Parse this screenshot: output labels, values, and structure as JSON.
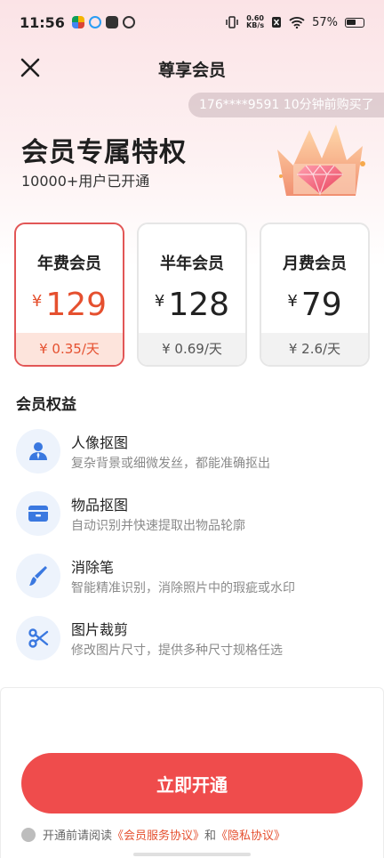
{
  "status": {
    "time": "11:56",
    "net_speed_top": "0.60",
    "net_speed_bottom": "KB/s",
    "battery": "57%"
  },
  "nav": {
    "title": "尊享会员",
    "close_icon": "close-icon"
  },
  "ticker": "176****9591  10分钟前购买了",
  "hero": {
    "title": "会员专属特权",
    "subtitle": "10000+用户已开通",
    "crown_icon": "crown-diamond-icon"
  },
  "plans": [
    {
      "name": "年费会员",
      "currency": "¥",
      "price": "129",
      "daily": "¥ 0.35/天",
      "selected": true
    },
    {
      "name": "半年会员",
      "currency": "¥",
      "price": "128",
      "daily": "¥ 0.69/天",
      "selected": false
    },
    {
      "name": "月费会员",
      "currency": "¥",
      "price": "79",
      "daily": "¥ 2.6/天",
      "selected": false
    }
  ],
  "benefits_title": "会员权益",
  "benefits": [
    {
      "name": "人像抠图",
      "desc": "复杂背景或细微发丝，都能准确抠出",
      "icon": "person-icon"
    },
    {
      "name": "物品抠图",
      "desc": "自动识别并快速提取出物品轮廓",
      "icon": "box-icon"
    },
    {
      "name": "消除笔",
      "desc": "智能精准识别，消除照片中的瑕疵或水印",
      "icon": "brush-icon"
    },
    {
      "name": "图片裁剪",
      "desc": "修改图片尺寸，提供多种尺寸规格任选",
      "icon": "scissors-icon"
    }
  ],
  "cta_label": "立即开通",
  "agreement": {
    "prefix": "开通前请阅读",
    "link1": "《会员服务协议》",
    "middle": "和",
    "link2": "《隐私协议》"
  },
  "colors": {
    "accent": "#ef4c4c",
    "price_accent": "#e5502f",
    "icon_blue": "#3a78e0"
  }
}
